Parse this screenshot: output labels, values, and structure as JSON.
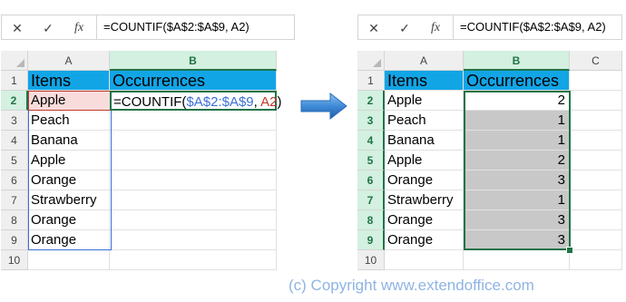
{
  "left": {
    "formula_bar": {
      "cancel_icon": "✕",
      "enter_icon": "✓",
      "fx_label": "fx",
      "formula": "=COUNTIF($A$2:$A$9, A2)"
    },
    "columns": [
      "A",
      "B"
    ],
    "rows": [
      "1",
      "2",
      "3",
      "4",
      "5",
      "6",
      "7",
      "8",
      "9",
      "10"
    ],
    "header": {
      "items": "Items",
      "occurrences": "Occurrences"
    },
    "items": [
      "Apple",
      "Peach",
      "Banana",
      "Apple",
      "Orange",
      "Strawberry",
      "Orange",
      "Orange"
    ],
    "edit_formula": {
      "prefix": "=COUNTIF(",
      "range": "$A$2:$A$9",
      "sep": ", ",
      "ref": "A2",
      "suffix": ")"
    }
  },
  "right": {
    "formula_bar": {
      "cancel_icon": "✕",
      "enter_icon": "✓",
      "fx_label": "fx",
      "formula": "=COUNTIF($A$2:$A$9, A2)"
    },
    "columns": [
      "A",
      "B",
      "C"
    ],
    "rows": [
      "1",
      "2",
      "3",
      "4",
      "5",
      "6",
      "7",
      "8",
      "9",
      "10"
    ],
    "header": {
      "items": "Items",
      "occurrences": "Occurrences"
    },
    "items": [
      "Apple",
      "Peach",
      "Banana",
      "Apple",
      "Orange",
      "Strawberry",
      "Orange",
      "Orange"
    ],
    "counts": [
      "2",
      "1",
      "1",
      "2",
      "3",
      "1",
      "3",
      "3"
    ]
  },
  "arrow_icon": "right-arrow-icon",
  "colors": {
    "header_fill": "#12a5e6",
    "excel_green": "#217346",
    "result_fill": "#c8c8c8",
    "range_blue": "#3b6fd6",
    "ref_red": "#c0392b"
  },
  "copyright": "(c) Copyright www.extendoffice.com"
}
